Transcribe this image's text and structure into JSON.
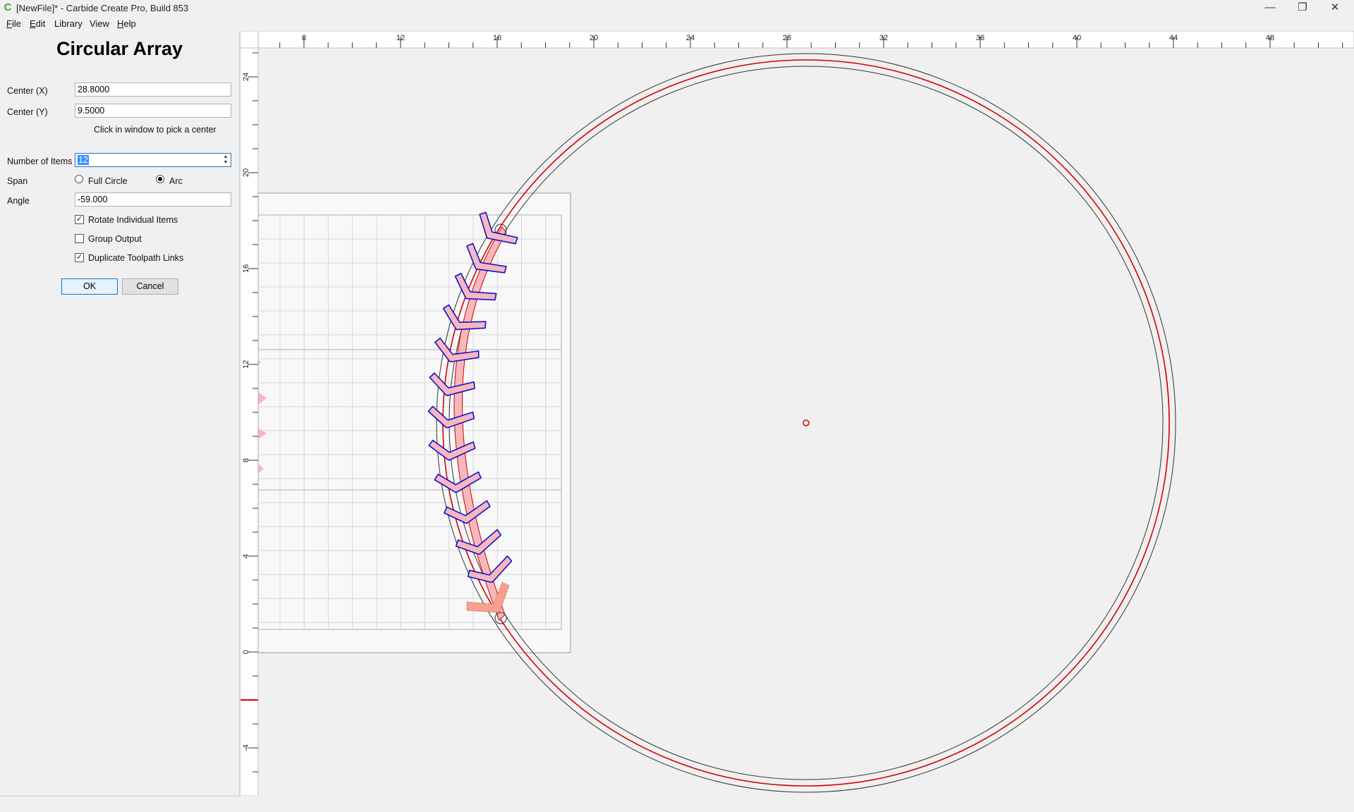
{
  "window": {
    "title": "[NewFile]* - Carbide Create Pro, Build 853",
    "app_icon": "carbide-create-icon",
    "controls": {
      "minimize": "—",
      "restore": "❐",
      "close": "✕"
    }
  },
  "menu": [
    {
      "underline": "F",
      "rest": "ile"
    },
    {
      "underline": "E",
      "rest": "dit"
    },
    {
      "underline": "",
      "rest": "Library"
    },
    {
      "underline": "",
      "rest": "View"
    },
    {
      "underline": "H",
      "rest": "elp"
    }
  ],
  "dialog": {
    "title": "Circular Array",
    "center_x_label": "Center (X)",
    "center_x_value": "28.8000",
    "center_y_label": "Center (Y)",
    "center_y_value": "9.5000",
    "pick_hint": "Click in window to pick a center",
    "num_items_label": "Number of Items",
    "num_items_value": "12",
    "span_label": "Span",
    "span_full_circle": "Full Circle",
    "span_arc": "Arc",
    "span_selected": "Arc",
    "angle_label": "Angle",
    "angle_value": "-59.000",
    "rotate_items_label": "Rotate Individual Items",
    "rotate_items_checked": true,
    "group_output_label": "Group Output",
    "group_output_checked": false,
    "duplicate_links_label": "Duplicate Toolpath Links",
    "duplicate_links_checked": true,
    "ok_label": "OK",
    "cancel_label": "Cancel"
  },
  "rulers": {
    "x_labels": [
      "8",
      "12",
      "16",
      "20",
      "24",
      "28",
      "32",
      "36",
      "40",
      "44",
      "48"
    ],
    "y_labels": [
      "24",
      "20",
      "16",
      "12",
      "8",
      "4",
      "0",
      "-4"
    ]
  },
  "colors": {
    "toolpath_red": "#d40000",
    "selection_blue": "#1010d0",
    "selected_fill": "#f6b8bc",
    "ghost_fill": "#f6a090",
    "stock_fill": "#f8f8f8"
  }
}
